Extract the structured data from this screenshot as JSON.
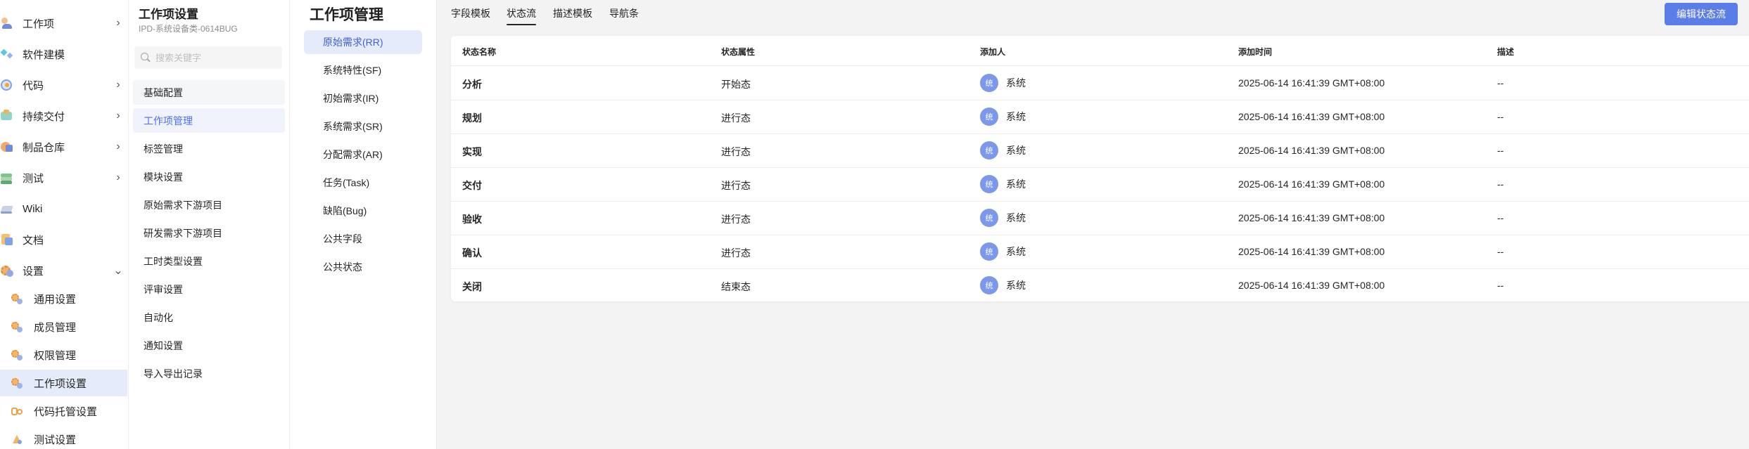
{
  "nav": {
    "items": [
      {
        "label": "工作项",
        "icon": "person-icon",
        "chevron": "›"
      },
      {
        "label": "软件建模",
        "icon": "model-icon",
        "chevron": ""
      },
      {
        "label": "代码",
        "icon": "code-icon",
        "chevron": "›"
      },
      {
        "label": "持续交付",
        "icon": "delivery-icon",
        "chevron": "›"
      },
      {
        "label": "制品仓库",
        "icon": "repository-icon",
        "chevron": "›"
      },
      {
        "label": "测试",
        "icon": "test-icon",
        "chevron": "›"
      },
      {
        "label": "Wiki",
        "icon": "wiki-icon",
        "chevron": ""
      },
      {
        "label": "文档",
        "icon": "document-icon",
        "chevron": ""
      },
      {
        "label": "设置",
        "icon": "settings-gear-icon",
        "chevron": "⌄"
      }
    ],
    "sub_items": [
      {
        "label": "通用设置",
        "icon": "general-settings-icon"
      },
      {
        "label": "成员管理",
        "icon": "member-gear-icon"
      },
      {
        "label": "权限管理",
        "icon": "permission-gear-icon"
      },
      {
        "label": "工作项设置",
        "icon": "workitem-settings-icon"
      },
      {
        "label": "代码托管设置",
        "icon": "code-hosting-icon"
      },
      {
        "label": "测试设置",
        "icon": "test-settings-icon"
      }
    ]
  },
  "settings": {
    "title": "工作项设置",
    "subtitle": "IPD-系统设备类-0614BUG",
    "search_placeholder": "搜索关键字",
    "items": [
      "基础配置",
      "工作项管理",
      "标签管理",
      "模块设置",
      "原始需求下游项目",
      "研发需求下游项目",
      "工时类型设置",
      "评审设置",
      "自动化",
      "通知设置",
      "导入导出记录"
    ]
  },
  "workitems": {
    "title": "工作项管理",
    "items": [
      "原始需求(RR)",
      "系统特性(SF)",
      "初始需求(IR)",
      "系统需求(SR)",
      "分配需求(AR)",
      "任务(Task)",
      "缺陷(Bug)",
      "公共字段",
      "公共状态"
    ]
  },
  "main": {
    "tabs": [
      "字段模板",
      "状态流",
      "描述模板",
      "导航条"
    ],
    "edit_button": "编辑状态流",
    "columns": [
      "状态名称",
      "状态属性",
      "添加人",
      "添加时间",
      "描述"
    ],
    "rows": [
      {
        "name": "分析",
        "attr": "开始态",
        "avatar": "统",
        "adder": "系统",
        "time": "2025-06-14 16:41:39 GMT+08:00",
        "desc": "--"
      },
      {
        "name": "规划",
        "attr": "进行态",
        "avatar": "统",
        "adder": "系统",
        "time": "2025-06-14 16:41:39 GMT+08:00",
        "desc": "--"
      },
      {
        "name": "实现",
        "attr": "进行态",
        "avatar": "统",
        "adder": "系统",
        "time": "2025-06-14 16:41:39 GMT+08:00",
        "desc": "--"
      },
      {
        "name": "交付",
        "attr": "进行态",
        "avatar": "统",
        "adder": "系统",
        "time": "2025-06-14 16:41:39 GMT+08:00",
        "desc": "--"
      },
      {
        "name": "验收",
        "attr": "进行态",
        "avatar": "统",
        "adder": "系统",
        "time": "2025-06-14 16:41:39 GMT+08:00",
        "desc": "--"
      },
      {
        "name": "确认",
        "attr": "进行态",
        "avatar": "统",
        "adder": "系统",
        "time": "2025-06-14 16:41:39 GMT+08:00",
        "desc": "--"
      },
      {
        "name": "关闭",
        "attr": "结束态",
        "avatar": "统",
        "adder": "系统",
        "time": "2025-06-14 16:41:39 GMT+08:00",
        "desc": "--"
      }
    ]
  },
  "colors": {
    "accent": "#5b7de8",
    "active_bg": "#e6ebfb",
    "avatar": "#7c98ea"
  }
}
